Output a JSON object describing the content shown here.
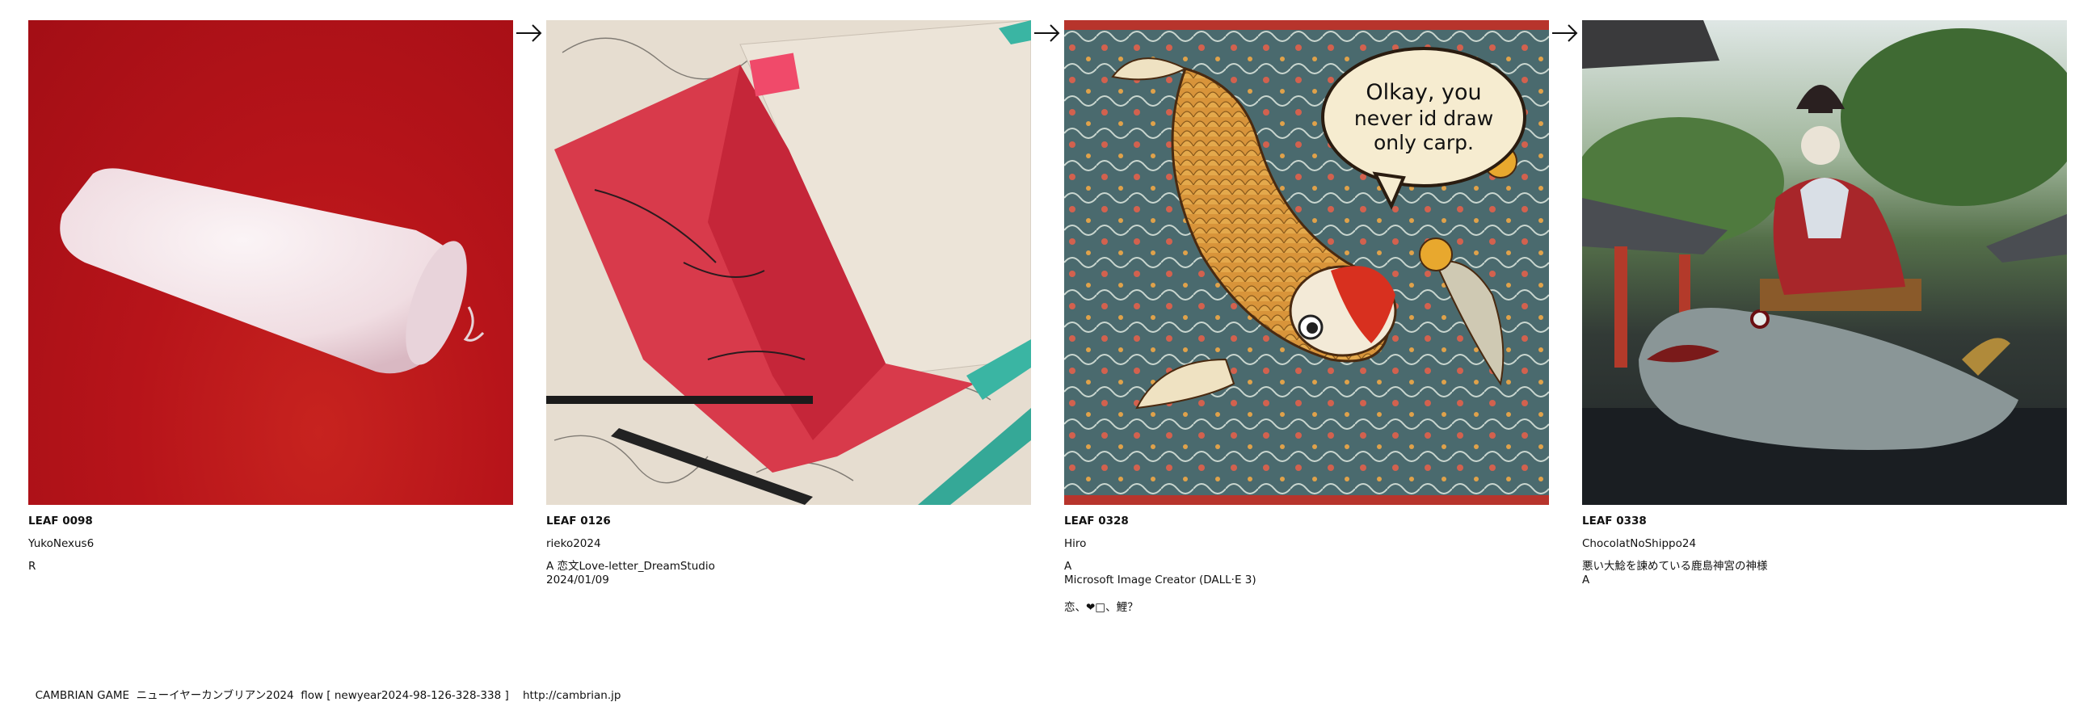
{
  "cards": [
    {
      "leaf": "LEAF 0098",
      "user": "YukoNexus6",
      "lines": [
        "R"
      ],
      "image": "rolled white towel on red surface"
    },
    {
      "leaf": "LEAF 0126",
      "user": "rieko2024",
      "lines": [
        "A 恋文Love-letter_DreamStudio",
        "2024/01/09"
      ],
      "image": "red paper letter over sketches with pencils"
    },
    {
      "leaf": "LEAF 0328",
      "user": "Hiro",
      "lines": [
        "A",
        "Microsoft Image Creator (DALL·E 3)",
        "",
        "恋、❤□、鯉？"
      ],
      "image": "illustrated koi fish with speech bubble",
      "bubble": [
        "Olkay, you",
        "never id draw",
        "only carp."
      ]
    },
    {
      "leaf": "LEAF 0338",
      "user": "ChocolatNoShippo24",
      "lines": [
        "悪い大鯰を諫めている鹿島神宮の神様",
        "A"
      ],
      "image": "deity figure riding a giant catfish before a shrine"
    }
  ],
  "footer": {
    "text": "CAMBRIAN GAME  ニューイヤーカンブリアン2024  flow [ newyear2024-98-126-328-338 ]",
    "url": "http://cambrian.jp"
  }
}
